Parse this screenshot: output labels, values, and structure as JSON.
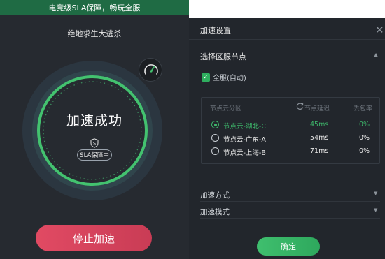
{
  "left_panel": {
    "banner": "电竞级SLA保障，畅玩全服",
    "game_title": "绝地求生大逃杀",
    "status": "加速成功",
    "sla_badge": "SLA保障中",
    "stop_button": "停止加速"
  },
  "dialog": {
    "title": "加速设置",
    "node_section": {
      "header": "选择区服节点",
      "auto_label": "全服(自动)",
      "auto_checked": true,
      "table": {
        "columns": {
          "name": "节点云分区",
          "latency": "节点延迟",
          "loss": "丢包率"
        },
        "rows": [
          {
            "name": "节点云-湖北-C",
            "latency": "45ms",
            "loss": "0%",
            "selected": true
          },
          {
            "name": "节点云-广东-A",
            "latency": "54ms",
            "loss": "0%",
            "selected": false
          },
          {
            "name": "节点云-上海-B",
            "latency": "71ms",
            "loss": "0%",
            "selected": false
          }
        ]
      }
    },
    "mode_label": "加速方式",
    "type_label": "加速模式",
    "confirm_button": "确定"
  },
  "colors": {
    "accent_green": "#3db56a",
    "stop_red": "#d9435c",
    "panel_bg": "#262a30",
    "dialog_bg": "#22262c"
  },
  "icons": [
    "gauge-icon",
    "shield-icon",
    "close-icon",
    "refresh-icon",
    "checkbox-check-icon",
    "caret-up-icon",
    "caret-down-icon"
  ]
}
